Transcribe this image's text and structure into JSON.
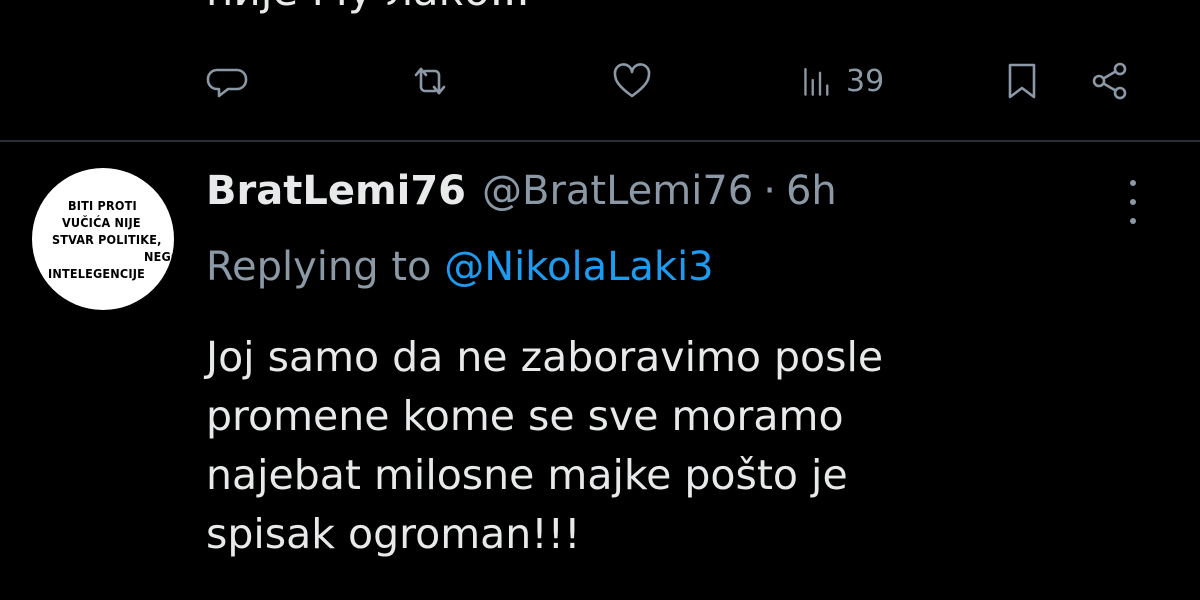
{
  "previous_tweet": {
    "text_fragment": "није Му лако...",
    "actions": {
      "views_count": "39"
    },
    "icons": [
      "reply-icon",
      "retweet-icon",
      "like-icon",
      "views-icon",
      "bookmark-icon",
      "share-icon"
    ]
  },
  "tweet": {
    "avatar": {
      "lines": [
        "BITI PROTI",
        "VUČIĆA NIJE",
        "STVAR POLITIKE,",
        "NEGO",
        "INTELEGENCIJE"
      ]
    },
    "display_name": "BratLemi76",
    "handle": "@BratLemi76",
    "separator": "·",
    "time": "6h",
    "replying_prefix": "Replying to",
    "replying_to": "@NikolaLaki3",
    "body_lines": [
      "Joj samo da ne zaboravimo posle",
      "promene kome se sve moramo",
      "najebat milosne majke pošto je",
      "spisak ogroman!!!"
    ]
  },
  "colors": {
    "background": "#000000",
    "text": "#e7e9ea",
    "muted": "#8b98a5",
    "link": "#1d9bf0"
  }
}
